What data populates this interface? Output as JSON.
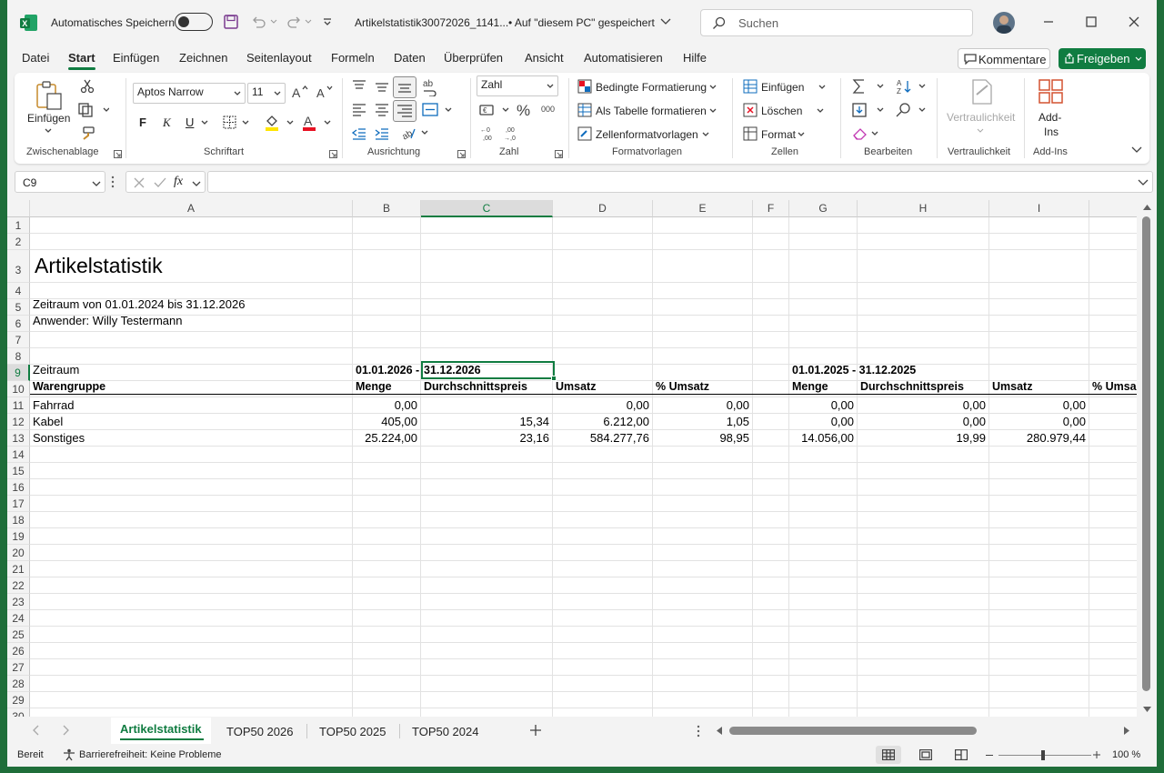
{
  "titlebar": {
    "autosave_label": "Automatisches Speichern",
    "filename": "Artikelstatistik30072026_1141...",
    "save_status": "• Auf \"diesem PC\" gespeichert",
    "search_placeholder": "Suchen"
  },
  "menu": [
    "Datei",
    "Start",
    "Einfügen",
    "Zeichnen",
    "Seitenlayout",
    "Formeln",
    "Daten",
    "Überprüfen",
    "Ansicht",
    "Automatisieren",
    "Hilfe"
  ],
  "actions": {
    "comments": "Kommentare",
    "share": "Freigeben"
  },
  "ribbon": {
    "paste": "Einfügen",
    "font_name": "Aptos Narrow",
    "font_size": "11",
    "bold": "F",
    "italic": "K",
    "underline": "U",
    "number_format": "Zahl",
    "cond_format": "Bedingte Formatierung",
    "as_table": "Als Tabelle formatieren",
    "cell_styles": "Zellenformatvorlagen",
    "insert": "Einfügen",
    "delete": "Löschen",
    "format": "Format",
    "sensitivity": "Vertraulichkeit",
    "addins_l1": "Add-",
    "addins_l2": "Ins",
    "groups": {
      "clipboard": "Zwischenablage",
      "font": "Schriftart",
      "alignment": "Ausrichtung",
      "number": "Zahl",
      "styles": "Formatvorlagen",
      "cells": "Zellen",
      "editing": "Bearbeiten",
      "sensitivity": "Vertraulichkeit",
      "addins": "Add-Ins"
    }
  },
  "formula": {
    "name_box": "C9",
    "fx": "fx",
    "content": ""
  },
  "columns": [
    "A",
    "B",
    "C",
    "D",
    "E",
    "F",
    "G",
    "H",
    "I"
  ],
  "rows": [
    "1",
    "2",
    "3",
    "4",
    "5",
    "6",
    "7",
    "8",
    "9",
    "10",
    "11",
    "12",
    "13",
    "14",
    "15",
    "16",
    "17",
    "18",
    "19",
    "20",
    "21",
    "22",
    "23",
    "24",
    "25",
    "26",
    "27",
    "28",
    "29",
    "30"
  ],
  "sheet": {
    "title": "Artikelstatistik",
    "period": "Zeitraum von 01.01.2024 bis 31.12.2026",
    "user": "Anwender: Willy Testermann",
    "zeitraum_label": "Zeitraum",
    "period1_b": "01.01.2026 -",
    "period1_c": "31.12.2026",
    "period2": "01.01.2025 - 31.12.2025",
    "headers": {
      "a": "Warengruppe",
      "b": "Menge",
      "c": "Durchschnittspreis",
      "d": "Umsatz",
      "e": "% Umsatz",
      "g": "Menge",
      "h": "Durchschnittspreis",
      "i": "Umsatz",
      "j": "% Umsa"
    },
    "data": [
      {
        "a": "Fahrrad",
        "b": "0,00",
        "c": "",
        "d": "0,00",
        "e": "0,00",
        "g": "0,00",
        "h": "0,00",
        "i": "0,00"
      },
      {
        "a": "Kabel",
        "b": "405,00",
        "c": "15,34",
        "d": "6.212,00",
        "e": "1,05",
        "g": "0,00",
        "h": "0,00",
        "i": "0,00"
      },
      {
        "a": "Sonstiges",
        "b": "25.224,00",
        "c": "23,16",
        "d": "584.277,76",
        "e": "98,95",
        "g": "14.056,00",
        "h": "19,99",
        "i": "280.979,44"
      }
    ]
  },
  "tabs": [
    "Artikelstatistik",
    "TOP50 2026",
    "TOP50 2025",
    "TOP50 2024"
  ],
  "status": {
    "ready": "Bereit",
    "accessibility": "Barrierefreiheit: Keine Probleme",
    "zoom": "100 %"
  }
}
